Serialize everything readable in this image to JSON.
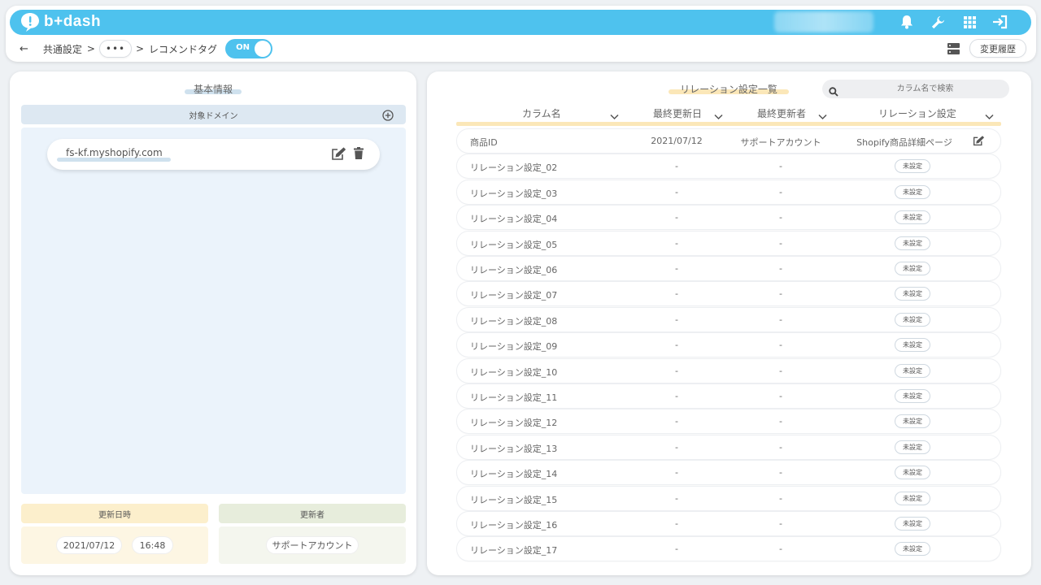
{
  "app": {
    "logo_text": "b+dash"
  },
  "breadcrumb": {
    "back": "←",
    "item1": "共通設定",
    "sep1": ">",
    "more": "•••",
    "sep2": ">",
    "current": "レコメンドタグ"
  },
  "toggle": {
    "label": "ON",
    "state": true
  },
  "header": {
    "history_button": "変更履歴"
  },
  "left": {
    "title": "基本情報",
    "domain_header": "対象ドメイン",
    "domain": "fs-kf.myshopify.com",
    "updated_at_label": "更新日時",
    "updated_date": "2021/07/12",
    "updated_time": "16:48",
    "updater_label": "更新者",
    "updater": "サポートアカウント"
  },
  "right": {
    "title": "リレーション設定一覧",
    "search_placeholder": "カラム名で検索",
    "columns": {
      "name": "カラム名",
      "date": "最終更新日",
      "user": "最終更新者",
      "relation": "リレーション設定"
    },
    "first_row": {
      "name": "商品ID",
      "date": "2021/07/12",
      "user": "サポートアカウント",
      "relation": "Shopify商品詳細ページ"
    },
    "unset_label": "未設定",
    "dash": "-",
    "rows": [
      "リレーション設定_02",
      "リレーション設定_03",
      "リレーション設定_04",
      "リレーション設定_05",
      "リレーション設定_06",
      "リレーション設定_07",
      "リレーション設定_08",
      "リレーション設定_09",
      "リレーション設定_10",
      "リレーション設定_11",
      "リレーション設定_12",
      "リレーション設定_13",
      "リレーション設定_14",
      "リレーション設定_15",
      "リレーション設定_16",
      "リレーション設定_17"
    ]
  },
  "colors": {
    "accent": "#4ec2ee",
    "domain_bg": "#ebf3fb",
    "date_box": "#fdf6e3",
    "user_box": "#f4f6ee"
  }
}
